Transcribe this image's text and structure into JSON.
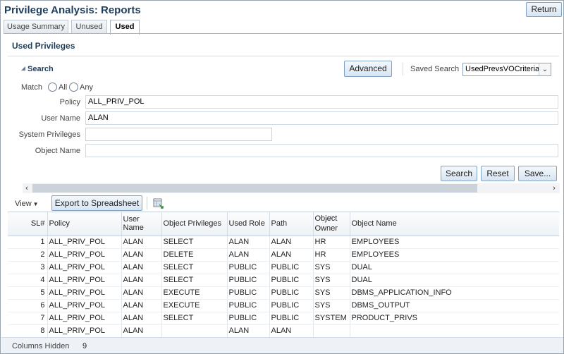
{
  "page": {
    "title": "Privilege Analysis: Reports",
    "return_label": "Return"
  },
  "tabs": [
    {
      "label": "Usage Summary"
    },
    {
      "label": "Unused"
    },
    {
      "label": "Used",
      "selected": true
    }
  ],
  "section": {
    "title": "Used Privileges"
  },
  "search": {
    "toggle_label": "Search",
    "advanced_label": "Advanced",
    "saved_search_label": "Saved Search",
    "saved_search_value": "UsedPrevsVOCriteria",
    "match_label": "Match",
    "match_all": "All",
    "match_any": "Any",
    "fields": {
      "policy_label": "Policy",
      "policy_value": "ALL_PRIV_POL",
      "user_label": "User Name",
      "user_value": "ALAN",
      "sys_label": "System Privileges",
      "sys_value": "",
      "obj_label": "Object Name",
      "obj_value": ""
    },
    "search_button": "Search",
    "reset_button": "Reset",
    "save_button": "Save..."
  },
  "toolbar": {
    "view_label": "View",
    "export_label": "Export to Spreadsheet"
  },
  "table": {
    "columns": [
      "SL#",
      "Policy",
      "User Name",
      "Object Privileges",
      "Used Role",
      "Path",
      "Object Owner",
      "Object Name"
    ],
    "rows": [
      [
        "1",
        "ALL_PRIV_POL",
        "ALAN",
        "SELECT",
        "ALAN",
        "ALAN",
        "HR",
        "EMPLOYEES"
      ],
      [
        "2",
        "ALL_PRIV_POL",
        "ALAN",
        "DELETE",
        "ALAN",
        "ALAN",
        "HR",
        "EMPLOYEES"
      ],
      [
        "3",
        "ALL_PRIV_POL",
        "ALAN",
        "SELECT",
        "PUBLIC",
        "PUBLIC",
        "SYS",
        "DUAL"
      ],
      [
        "4",
        "ALL_PRIV_POL",
        "ALAN",
        "SELECT",
        "PUBLIC",
        "PUBLIC",
        "SYS",
        "DUAL"
      ],
      [
        "5",
        "ALL_PRIV_POL",
        "ALAN",
        "EXECUTE",
        "PUBLIC",
        "PUBLIC",
        "SYS",
        "DBMS_APPLICATION_INFO"
      ],
      [
        "6",
        "ALL_PRIV_POL",
        "ALAN",
        "EXECUTE",
        "PUBLIC",
        "PUBLIC",
        "SYS",
        "DBMS_OUTPUT"
      ],
      [
        "7",
        "ALL_PRIV_POL",
        "ALAN",
        "SELECT",
        "PUBLIC",
        "PUBLIC",
        "SYSTEM",
        "PRODUCT_PRIVS"
      ],
      [
        "8",
        "ALL_PRIV_POL",
        "ALAN",
        "",
        "ALAN",
        "ALAN",
        "",
        ""
      ]
    ]
  },
  "footer": {
    "columns_hidden_label": "Columns Hidden",
    "columns_hidden_value": "9"
  },
  "colors": {
    "title": "#1f3e5c",
    "button_border": "#7fa3c7",
    "button_gradient_top": "#f4f8fc",
    "button_gradient_bottom": "#d7e5f3"
  }
}
